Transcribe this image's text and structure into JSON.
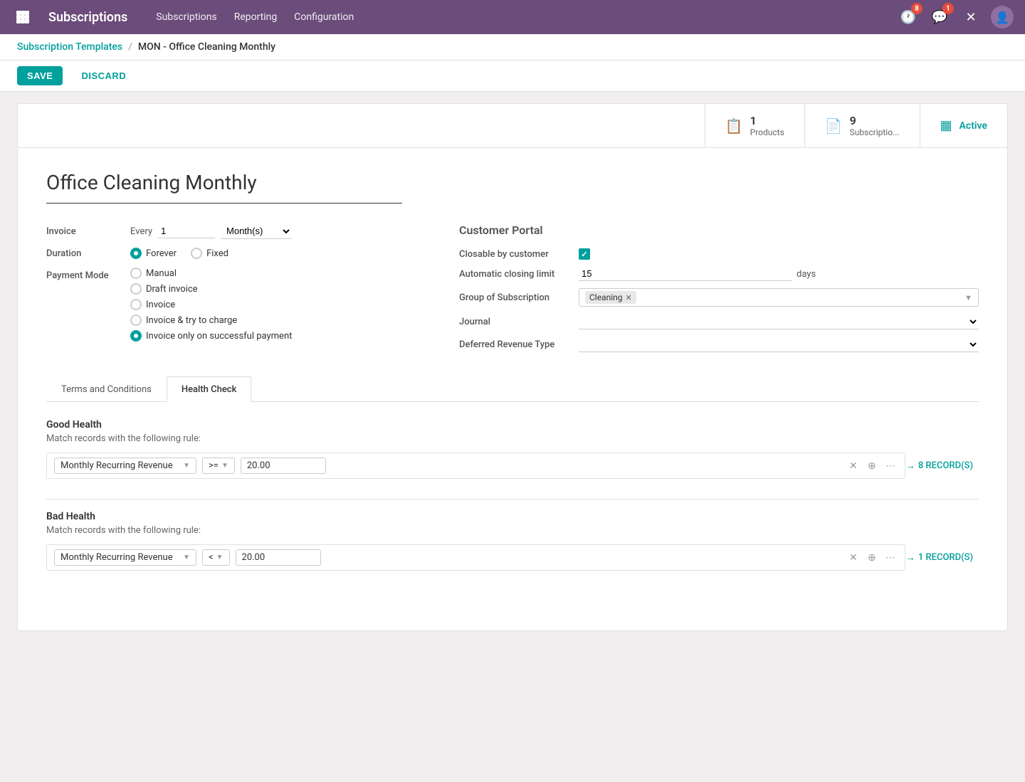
{
  "app": {
    "title": "Subscriptions",
    "grid_icon": "grid-icon"
  },
  "topnav": {
    "links": [
      "Subscriptions",
      "Reporting",
      "Configuration"
    ],
    "notification_count": "8",
    "message_count": "1"
  },
  "breadcrumb": {
    "parent": "Subscription Templates",
    "separator": "/",
    "current": "MON - Office Cleaning Monthly"
  },
  "actions": {
    "save": "SAVE",
    "discard": "DISCARD"
  },
  "stats": {
    "products": {
      "count": "1",
      "label": "Products"
    },
    "subscriptions": {
      "count": "9",
      "label": "Subscriptio..."
    },
    "active": {
      "label": "Active"
    }
  },
  "form": {
    "title": "Office Cleaning Monthly",
    "invoice_label": "Invoice",
    "invoice_every": "Every",
    "invoice_number": "1",
    "invoice_period": "Month(s)",
    "duration_label": "Duration",
    "duration_forever": "Forever",
    "duration_fixed": "Fixed",
    "duration_selected": "forever",
    "payment_mode_label": "Payment Mode",
    "payment_modes": [
      {
        "id": "manual",
        "label": "Manual",
        "checked": false
      },
      {
        "id": "draft",
        "label": "Draft invoice",
        "checked": false
      },
      {
        "id": "invoice",
        "label": "Invoice",
        "checked": false
      },
      {
        "id": "invoice_try",
        "label": "Invoice & try to charge",
        "checked": false
      },
      {
        "id": "invoice_success",
        "label": "Invoice only on successful payment",
        "checked": true
      }
    ]
  },
  "customer_portal": {
    "title": "Customer Portal",
    "closable_label": "Closable by customer",
    "closable_checked": true,
    "auto_close_label": "Automatic closing limit",
    "auto_close_value": "15",
    "auto_close_unit": "days",
    "group_label": "Group of Subscription",
    "group_tag": "Cleaning",
    "journal_label": "Journal",
    "journal_value": "",
    "deferred_label": "Deferred Revenue Type",
    "deferred_value": ""
  },
  "tabs": {
    "terms": "Terms and Conditions",
    "health_check": "Health Check",
    "active_tab": "health_check"
  },
  "health_check": {
    "good_health": {
      "title": "Good Health",
      "subtitle": "Match records with the following rule:",
      "records_count": "8 RECORD(S)",
      "field": "Monthly Recurring Revenue",
      "operator": ">=",
      "value": "20.00"
    },
    "bad_health": {
      "title": "Bad Health",
      "subtitle": "Match records with the following rule:",
      "records_count": "1 RECORD(S)",
      "field": "Monthly Recurring Revenue",
      "operator": "<",
      "value": "20.00"
    }
  }
}
